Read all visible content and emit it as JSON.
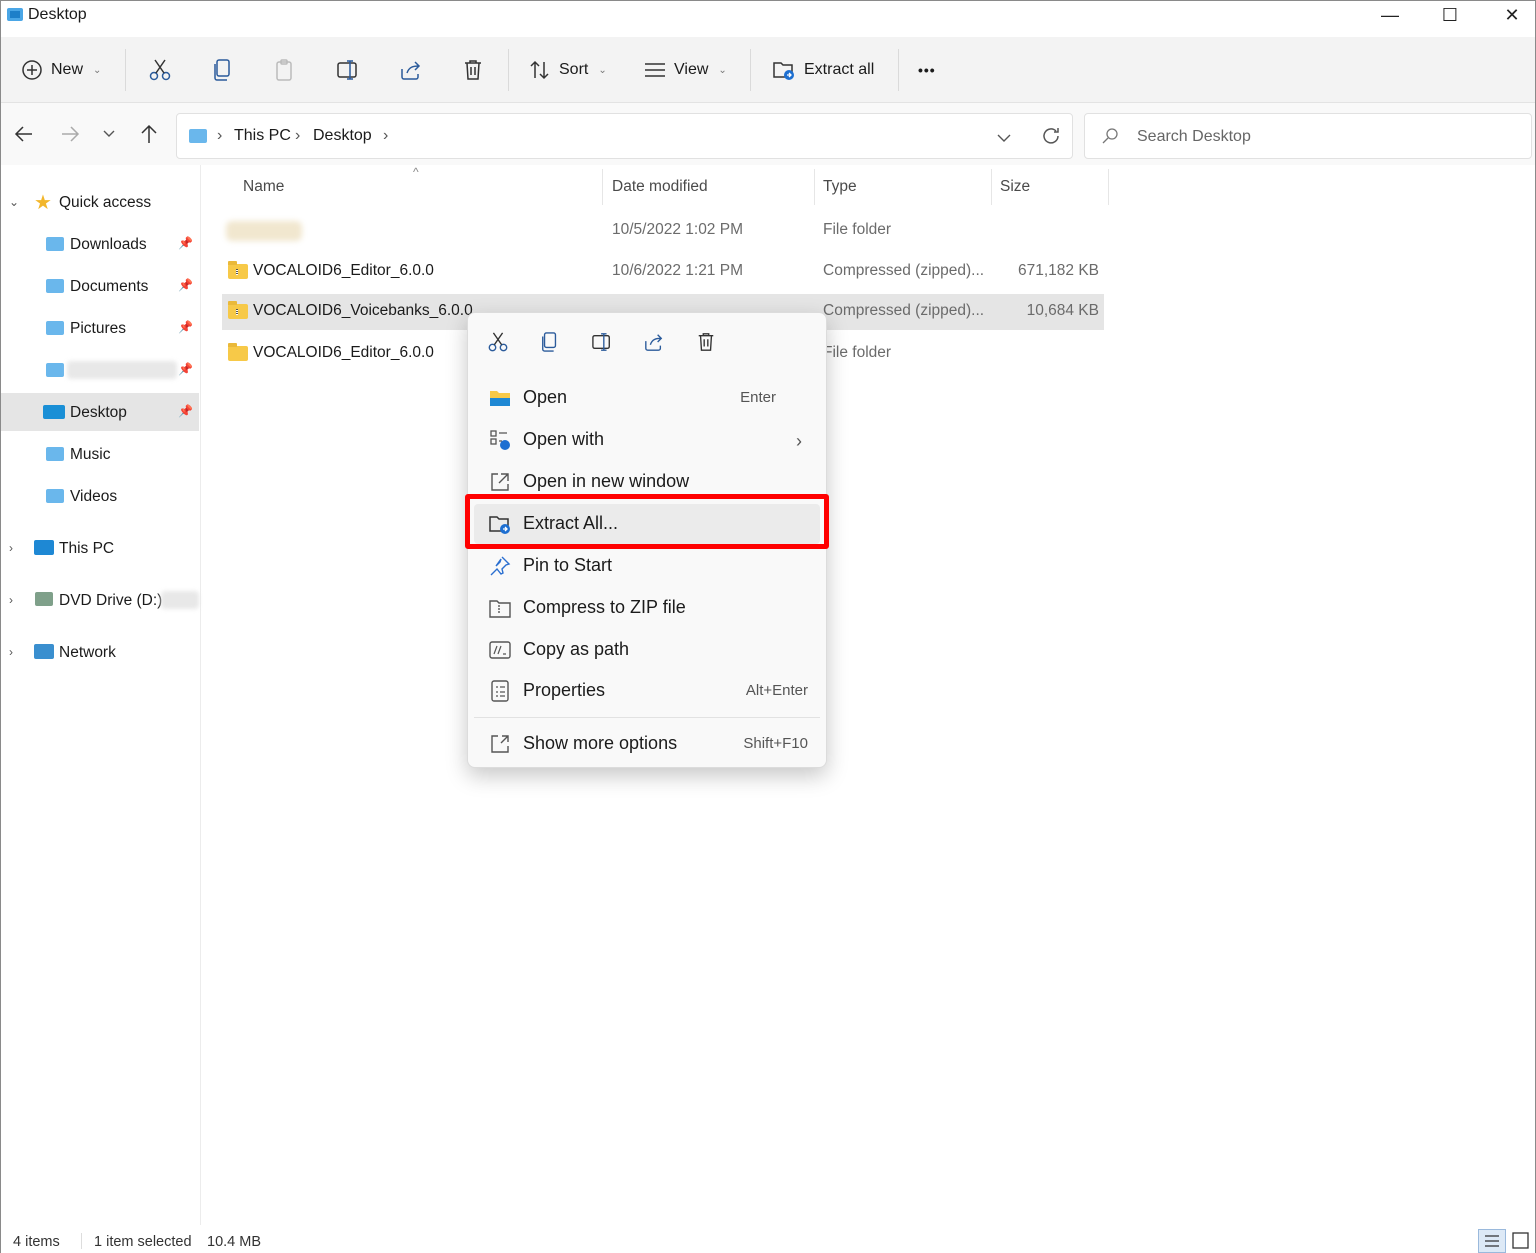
{
  "window": {
    "title": "Desktop",
    "minimize_glyph": "—",
    "maximize_glyph": "☐",
    "close_glyph": "✕"
  },
  "commandbar": {
    "new_label": "New",
    "sort_label": "Sort",
    "view_label": "View",
    "extract_all_label": "Extract all",
    "more_glyph": "•••",
    "icons": [
      "plus-circle-icon",
      "cut-icon",
      "copy-icon",
      "paste-icon",
      "rename-icon",
      "share-icon",
      "delete-icon",
      "sort-icon",
      "view-icon",
      "extract-icon"
    ]
  },
  "address": {
    "crumbs": [
      "This PC",
      "Desktop"
    ],
    "search_placeholder": "Search Desktop"
  },
  "navpane": {
    "quick_access": "Quick access",
    "items": [
      {
        "label": "Downloads",
        "pinned": true
      },
      {
        "label": "Documents",
        "pinned": true
      },
      {
        "label": "Pictures",
        "pinned": true
      },
      {
        "label": "",
        "pinned": true
      },
      {
        "label": "Desktop",
        "pinned": true,
        "selected": true
      },
      {
        "label": "Music",
        "pinned": false
      },
      {
        "label": "Videos",
        "pinned": false
      }
    ],
    "this_pc": "This PC",
    "dvd": "DVD Drive (D:)",
    "network": "Network"
  },
  "filelist": {
    "columns": {
      "name": "Name",
      "date": "Date modified",
      "type": "Type",
      "size": "Size"
    },
    "rows": [
      {
        "name": "",
        "date": "10/5/2022 1:02 PM",
        "type": "File folder",
        "size": ""
      },
      {
        "name": "VOCALOID6_Editor_6.0.0",
        "date": "10/6/2022 1:21 PM",
        "type": "Compressed (zipped)...",
        "size": "671,182 KB"
      },
      {
        "name": "VOCALOID6_Voicebanks_6.0.0",
        "date": "",
        "type": "Compressed (zipped)...",
        "size": "10,684 KB",
        "selected": true
      },
      {
        "name": "VOCALOID6_Editor_6.0.0",
        "date": "",
        "type": "File folder",
        "size": ""
      }
    ]
  },
  "context_menu": {
    "items": [
      {
        "label": "Open",
        "shortcut": "Enter"
      },
      {
        "label": "Open with",
        "shortcut": ""
      },
      {
        "label": "Open in new window",
        "shortcut": ""
      },
      {
        "label": "Extract All...",
        "shortcut": ""
      },
      {
        "label": "Pin to Start",
        "shortcut": ""
      },
      {
        "label": "Compress to ZIP file",
        "shortcut": ""
      },
      {
        "label": "Copy as path",
        "shortcut": ""
      },
      {
        "label": "Properties",
        "shortcut": "Alt+Enter"
      },
      {
        "label": "Show more options",
        "shortcut": "Shift+F10"
      }
    ],
    "highlight_color": "#ff0000"
  },
  "statusbar": {
    "count": "4 items",
    "selection": "1 item selected",
    "size": "10.4 MB"
  }
}
